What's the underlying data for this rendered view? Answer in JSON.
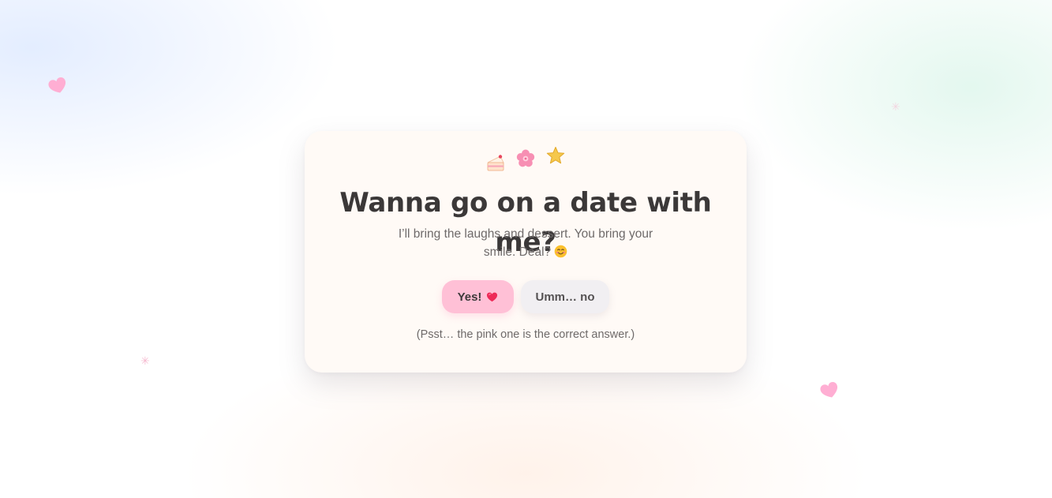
{
  "decorations": {
    "hearts": [
      "heart-icon",
      "heart-icon"
    ],
    "sparkles": [
      "sparkle-icon",
      "sparkle-icon"
    ],
    "heart_color": "#ffaed3"
  },
  "card": {
    "emojis": [
      "cake-icon",
      "cherry-blossom-icon",
      "star-icon"
    ],
    "title": "Wanna go on a date with me?",
    "subtitle": "I’ll bring the laughs and dessert. You bring your smile. Deal?",
    "subtitle_emoji": "smiling-face-icon",
    "yes_button": {
      "label": "Yes!",
      "icon": "heart-icon",
      "color": "#ffc0d6"
    },
    "no_button": {
      "label": "Umm… no",
      "color": "#f1eff2"
    },
    "hint": "(Psst… the pink one is the correct answer.)",
    "background": "#fffaf6"
  }
}
